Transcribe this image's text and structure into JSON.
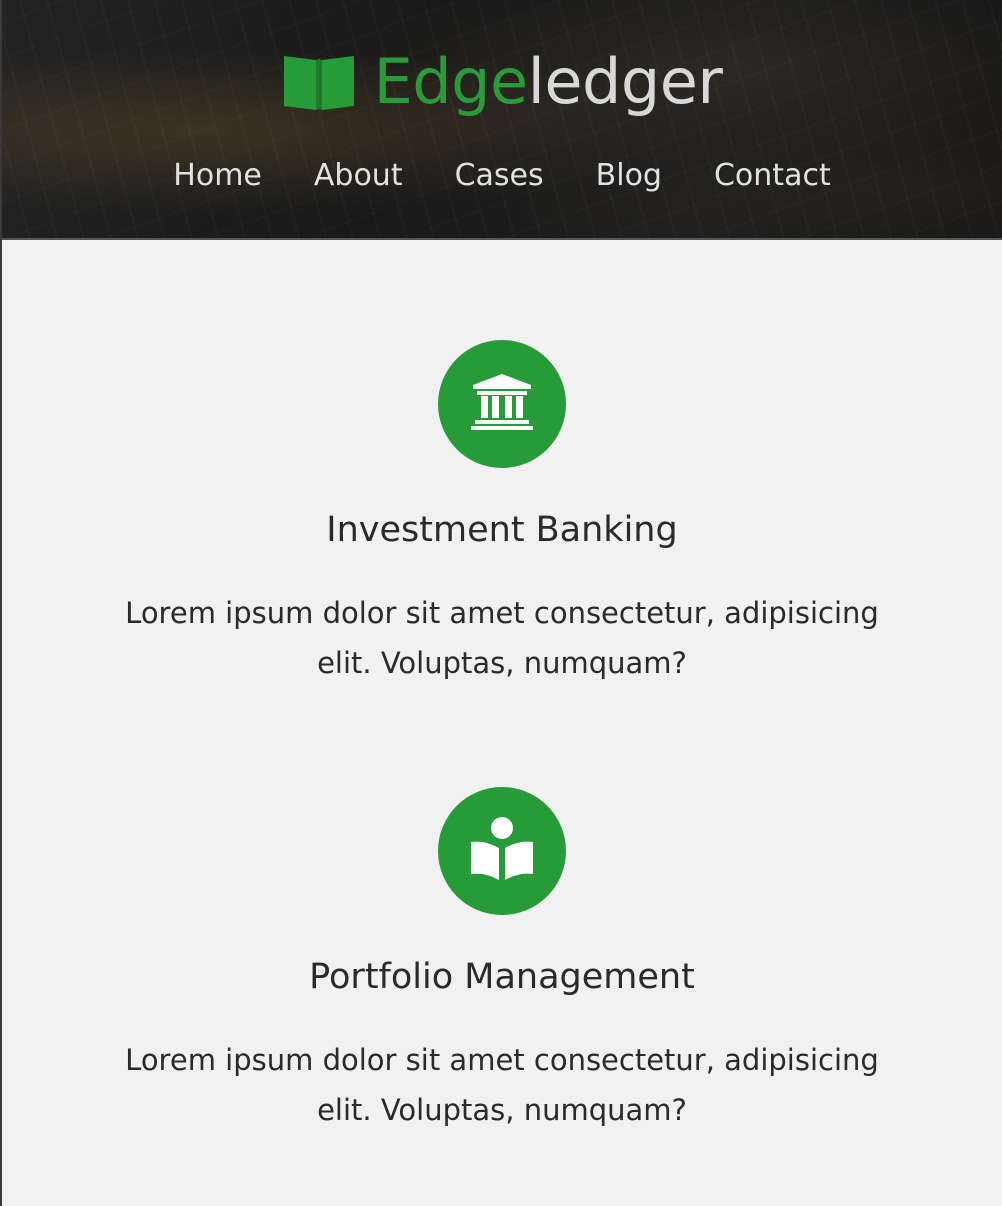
{
  "brand": {
    "name_accent": "Edge",
    "name_rest": "ledger",
    "logo_icon": "open-book-icon",
    "accent_color": "#279b38"
  },
  "nav": {
    "items": [
      "Home",
      "About",
      "Cases",
      "Blog",
      "Contact"
    ]
  },
  "services": [
    {
      "icon": "bank-building-icon",
      "title": "Investment Banking",
      "description": "Lorem ipsum dolor sit amet consectetur, adipisicing elit. Voluptas, numquam?"
    },
    {
      "icon": "reader-book-icon",
      "title": "Portfolio Management",
      "description": "Lorem ipsum dolor sit amet consectetur, adipisicing elit. Voluptas, numquam?"
    }
  ]
}
